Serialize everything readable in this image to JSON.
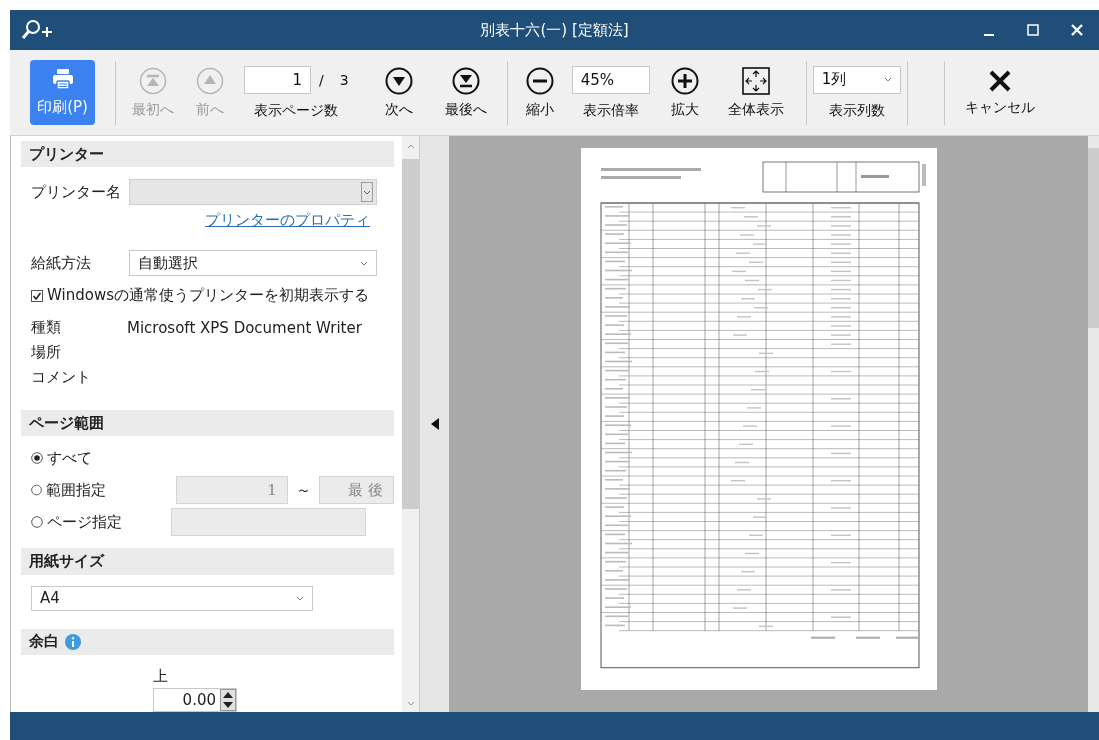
{
  "window": {
    "title": "別表十六(一) [定額法]"
  },
  "toolbar": {
    "print": {
      "label": "印刷(P)"
    },
    "first": {
      "label": "最初へ",
      "disabled": true
    },
    "prev": {
      "label": "前へ",
      "disabled": true
    },
    "page": {
      "value": "1",
      "separator": "/",
      "total": "3",
      "label": "表示ページ数"
    },
    "next": {
      "label": "次へ",
      "disabled": false
    },
    "last": {
      "label": "最後へ",
      "disabled": false
    },
    "zoom_out": {
      "label": "縮小",
      "disabled": false
    },
    "zoom": {
      "value": "45%",
      "label": "表示倍率"
    },
    "zoom_in": {
      "label": "拡大",
      "disabled": false
    },
    "fit": {
      "label": "全体表示",
      "disabled": false
    },
    "columns": {
      "value": "1列",
      "label": "表示列数"
    },
    "cancel": {
      "label": "キャンセル",
      "disabled": false
    }
  },
  "printer": {
    "heading": "プリンター",
    "name_label": "プリンター名",
    "properties_link": "プリンターのプロパティ",
    "source_label": "給紙方法",
    "source_value": "自動選択",
    "default_checkbox": {
      "label": "Windowsの通常使うプリンターを初期表示する",
      "checked": true
    },
    "info": [
      {
        "label": "種類",
        "value": "Microsoft XPS Document Writer"
      },
      {
        "label": "場所"
      },
      {
        "label": "コメント"
      }
    ]
  },
  "page_range": {
    "heading": "ページ範囲",
    "options": [
      {
        "label": "すべて",
        "selected": true
      },
      {
        "label": "範囲指定",
        "selected": false
      },
      {
        "label": "ページ指定",
        "selected": false
      }
    ],
    "range_from": "1",
    "range_sep": "～",
    "range_to": "最 後"
  },
  "paper_size": {
    "heading": "用紙サイズ",
    "value": "A4"
  },
  "margins": {
    "heading": "余白",
    "top_label": "上",
    "top_value": "0.00"
  }
}
